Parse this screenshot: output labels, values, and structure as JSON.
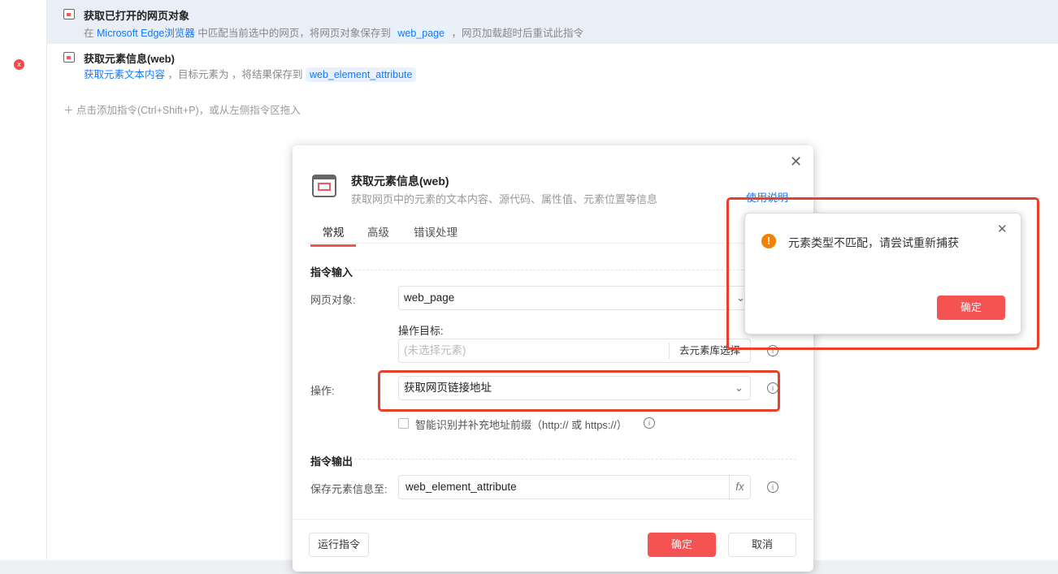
{
  "flow": {
    "steps": [
      {
        "title": "获取已打开的网页对象",
        "desc_pre": "在",
        "desc_link": "Microsoft Edge浏览器",
        "desc_mid": "中匹配当前选中的网页，将网页对象保存到",
        "var": "web_page",
        "desc_post": "，网页加载超时后重试此指令"
      },
      {
        "title": "获取元素信息(web)",
        "desc_link": "获取元素文本内容",
        "desc_mid": "，目标元素为 ，将结果保存到",
        "var": "web_element_attribute"
      }
    ],
    "add_hint": "点击添加指令(Ctrl+Shift+P)，或从左侧指令区拖入",
    "error_badge": "x"
  },
  "dialog": {
    "title": "获取元素信息(web)",
    "subtitle": "获取网页中的元素的文本内容、源代码、属性值、元素位置等信息",
    "help": "使用说明",
    "tabs": [
      "常规",
      "高级",
      "错误处理"
    ],
    "input_section": "指令输入",
    "web_obj_label": "网页对象:",
    "web_obj_value": "web_page",
    "target_label": "操作目标:",
    "target_placeholder": "(未选择元素)",
    "target_btn": "去元素库选择",
    "op_label": "操作:",
    "op_value": "获取网页链接地址",
    "checkbox_label": "智能识别并补充地址前缀（http:// 或 https://）",
    "output_section": "指令输出",
    "save_label": "保存元素信息至:",
    "save_value": "web_element_attribute",
    "fx": "fx",
    "run": "运行指令",
    "ok": "确定",
    "cancel": "取消"
  },
  "alert": {
    "message": "元素类型不匹配，请尝试重新捕获",
    "ok": "确定"
  },
  "colors": {
    "accent": "#f55252",
    "link": "#1677ff",
    "annotation": "#e8402a"
  }
}
